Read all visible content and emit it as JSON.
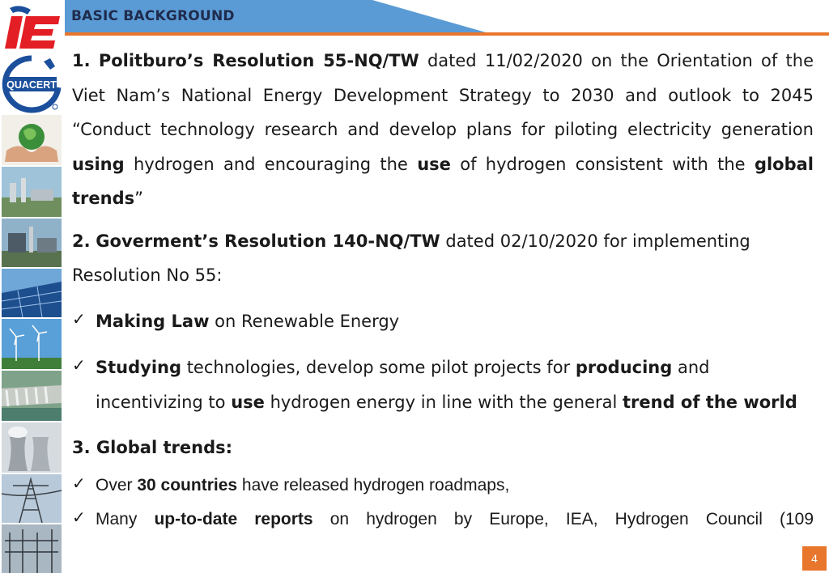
{
  "header": {
    "title": "BASIC BACKGROUND"
  },
  "sidebar": {
    "quacert_label": "QUACERT"
  },
  "section1": {
    "num": "1.",
    "title": "Politburo’s Resolution 55-NQ/TW",
    "text_a": " dated 11/02/2020 on the Orientation of the Viet Nam’s National Energy Development Strategy to 2030 and outlook to 2045 “Conduct technology research and develop plans for piloting electricity generation ",
    "b1": "using",
    "text_b": " hydrogen and encouraging the ",
    "b2": "use",
    "text_c": " of hydrogen consistent with the ",
    "b3": "global trends",
    "text_d": "”"
  },
  "section2": {
    "num": "2.",
    "title": "Goverment’s Resolution 140-NQ/TW",
    "text": " dated 02/10/2020 for implementing Resolution No 55:",
    "check_mark": "✓",
    "item1": {
      "b": "Making Law",
      "text": " on Renewable Energy"
    },
    "item2": {
      "b1": "Studying",
      "t1": " technologies, develop some pilot projects for ",
      "b2": "producing",
      "t2": " and incentivizing to ",
      "b3": "use",
      "t3": " hydrogen energy in line with the general ",
      "b4": "trend of the world"
    }
  },
  "section3": {
    "title": "3. Global trends:",
    "item1": {
      "t1": "Over ",
      "b": "30 countries",
      "t2": " have released hydrogen roadmaps,"
    },
    "item2": {
      "t1": "Many ",
      "b": "up-to-date reports",
      "t2": " on hydrogen by Europe, IEA, Hydrogen Council (109"
    }
  },
  "page_number": "4",
  "colors": {
    "header_blue": "#5b9bd5",
    "header_line": "#e8762c",
    "logo_red": "#e31e24",
    "logo_blue": "#1b4f9c",
    "page_badge": "#e8762c"
  }
}
